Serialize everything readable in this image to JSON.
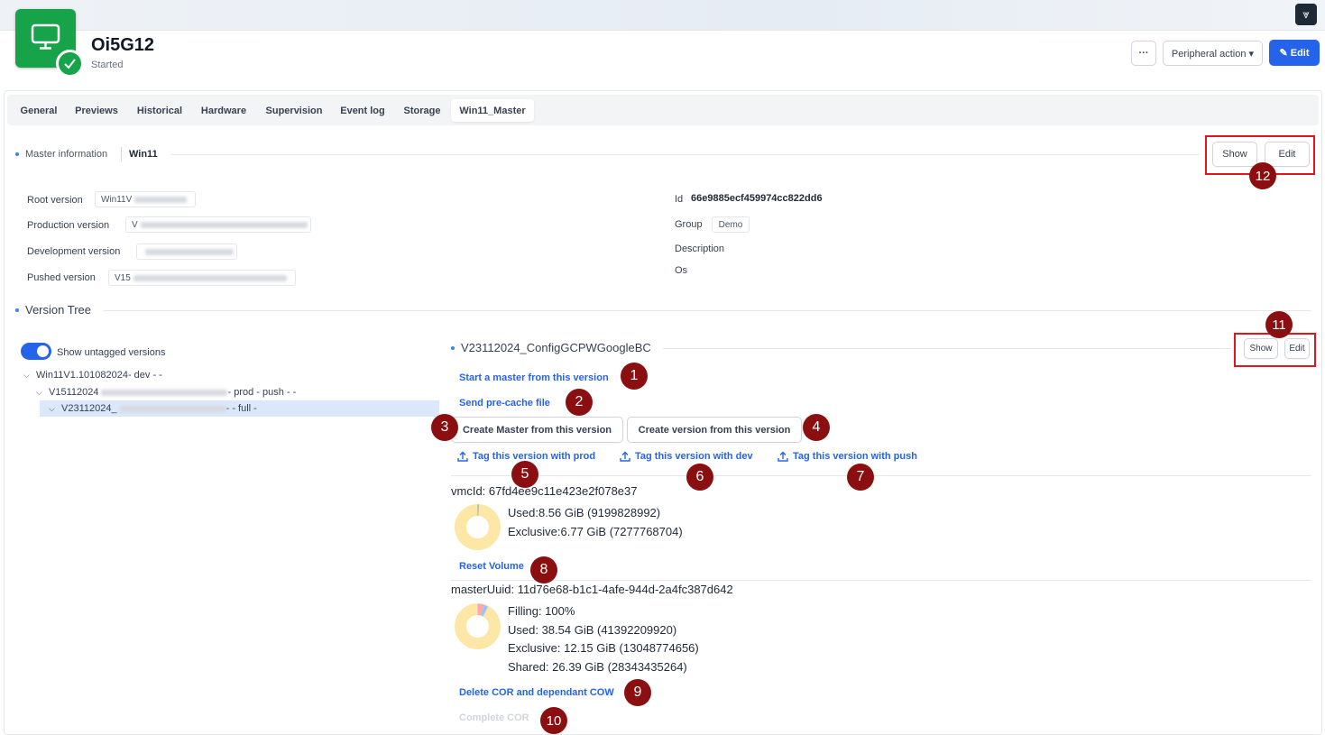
{
  "header": {
    "vm_name": "Oi5G12",
    "vm_status": "Started",
    "more_label": "···",
    "peripheral_label": "Peripheral action ▾",
    "edit_label": "✎ Edit"
  },
  "tabs": [
    {
      "label": "General"
    },
    {
      "label": "Previews"
    },
    {
      "label": "Historical"
    },
    {
      "label": "Hardware"
    },
    {
      "label": "Supervision"
    },
    {
      "label": "Event log"
    },
    {
      "label": "Storage"
    },
    {
      "label": "Win11_Master",
      "active": true
    }
  ],
  "master_info": {
    "section_label": "Master information",
    "name": "Win11",
    "show_label": "Show",
    "edit_label": "Edit",
    "fields_left": [
      {
        "label": "Root version",
        "value": "Win11V"
      },
      {
        "label": "Production version",
        "value": "V"
      },
      {
        "label": "Development version",
        "value": ""
      },
      {
        "label": "Pushed version",
        "value": "V15"
      }
    ],
    "id_label": "Id",
    "id_value": "66e9885ecf459974cc822dd6",
    "group_label": "Group",
    "group_value": "Demo",
    "description_label": "Description",
    "os_label": "Os"
  },
  "version_tree": {
    "section_label": "Version Tree",
    "toggle_label": "Show untagged versions",
    "toggle_on": true,
    "nodes": [
      {
        "prefix": "Win11V1.101082024",
        "suffix": " - dev - -"
      },
      {
        "prefix": "V15112024",
        "suffix": " - prod - push - -"
      },
      {
        "prefix": "V23112024_",
        "suffix": " - - full -"
      }
    ]
  },
  "version_detail": {
    "title": "V23112024_ConfigGCPWGoogleBC",
    "show_label": "Show",
    "edit_label": "Edit",
    "start_master_link": "Start a master from this version",
    "send_precache_link": "Send pre-cache file",
    "create_master_btn": "Create Master from this version",
    "create_version_btn": "Create version from this version",
    "tag_prod": "Tag this version with prod",
    "tag_dev": "Tag this version with dev",
    "tag_push": "Tag this version with push",
    "vmcid_line": "vmcId: 67fd4ee9c11e423e2f078e37",
    "vmc_used": "Used:8.56 GiB (9199828992)",
    "vmc_exclusive": "Exclusive:6.77 GiB (7277768704)",
    "reset_volume_link": "Reset Volume",
    "master_uuid_line": "masterUuid: 11d76e68-b1c1-4afe-944d-2a4fc387d642",
    "master_filling": "Filling: 100%",
    "master_used": "Used: 38.54 GiB (41392209920)",
    "master_exclusive": "Exclusive: 12.15 GiB (13048774656)",
    "master_shared": "Shared: 26.39 GiB (28343435264)",
    "delete_cor_link": "Delete COR and dependant COW",
    "complete_cor_link": "Complete COR"
  },
  "markers": [
    "1",
    "2",
    "3",
    "4",
    "5",
    "6",
    "7",
    "8",
    "9",
    "10",
    "11",
    "12"
  ],
  "colors": {
    "accent": "#2563eb",
    "status_green": "#16a34a",
    "marker": "#8b0f10",
    "highlight_box": "#e0161f",
    "donut_fill": "#fde7a6"
  }
}
